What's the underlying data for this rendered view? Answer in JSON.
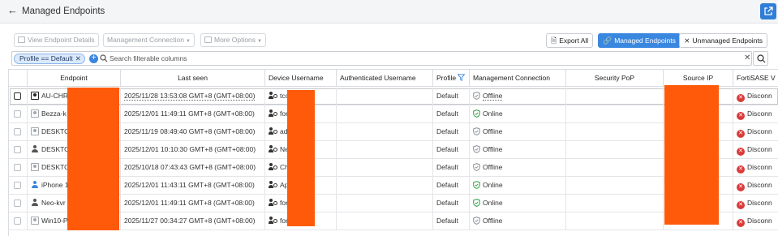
{
  "header": {
    "title": "Managed Endpoints",
    "back_icon": "arrow-left-icon",
    "external_icon": "external-link-icon"
  },
  "toolbar": {
    "view_details": "View Endpoint Details",
    "management_connection": "Management Connection",
    "more_options": "More Options",
    "export_all": "Export All",
    "managed_endpoints": "Managed Endpoints",
    "unmanaged_endpoints": "Unmanaged Endpoints"
  },
  "filter": {
    "chip": "Profile == Default",
    "placeholder": "Search filterable columns"
  },
  "table": {
    "columns": [
      "Endpoint",
      "Last seen",
      "Device Username",
      "Authenticated Username",
      "Profile",
      "Management Connection",
      "Security PoP",
      "Source IP",
      "FortiSASE V"
    ],
    "rows": [
      {
        "endpoint": "AU-CHR",
        "last_seen": "2025/11/28 13:53:08 GMT+8 (GMT+08:00)",
        "username": "tcc",
        "profile": "Default",
        "connection": "Offline",
        "fortisase": "Disconn"
      },
      {
        "endpoint": "Bezza-k",
        "last_seen": "2025/12/01 11:49:11 GMT+8 (GMT+08:00)",
        "username": "for",
        "profile": "Default",
        "connection": "Online",
        "fortisase": "Disconn"
      },
      {
        "endpoint": "DESKTO",
        "last_seen": "2025/11/19 08:49:40 GMT+8 (GMT+08:00)",
        "username": "adr",
        "profile": "Default",
        "connection": "Offline",
        "fortisase": "Disconn"
      },
      {
        "endpoint": "DESKTO",
        "last_seen": "2025/12/01 10:10:30 GMT+8 (GMT+08:00)",
        "username": "Nev",
        "profile": "Default",
        "connection": "Offline",
        "fortisase": "Disconn"
      },
      {
        "endpoint": "DESKTO",
        "last_seen": "2025/10/18 07:43:43 GMT+8 (GMT+08:00)",
        "username": "Chi",
        "profile": "Default",
        "connection": "Offline",
        "fortisase": "Disconn"
      },
      {
        "endpoint": "iPhone 1",
        "last_seen": "2025/12/01 11:43:11 GMT+8 (GMT+08:00)",
        "username": "App",
        "profile": "Default",
        "connection": "Online",
        "fortisase": "Disconn"
      },
      {
        "endpoint": "Neo-kvr",
        "last_seen": "2025/12/01 11:49:11 GMT+8 (GMT+08:00)",
        "username": "for",
        "profile": "Default",
        "connection": "Online",
        "fortisase": "Disconn"
      },
      {
        "endpoint": "Win10-P",
        "last_seen": "2025/11/27 00:34:27 GMT+8 (GMT+08:00)",
        "username": "for",
        "profile": "Default",
        "connection": "Offline",
        "fortisase": "Disconn"
      }
    ]
  },
  "colors": {
    "accent": "#3a87e0",
    "online": "#2e9e44",
    "offline": "#8a9096",
    "error": "#d93b3b",
    "redaction": "#ff5a0a"
  }
}
